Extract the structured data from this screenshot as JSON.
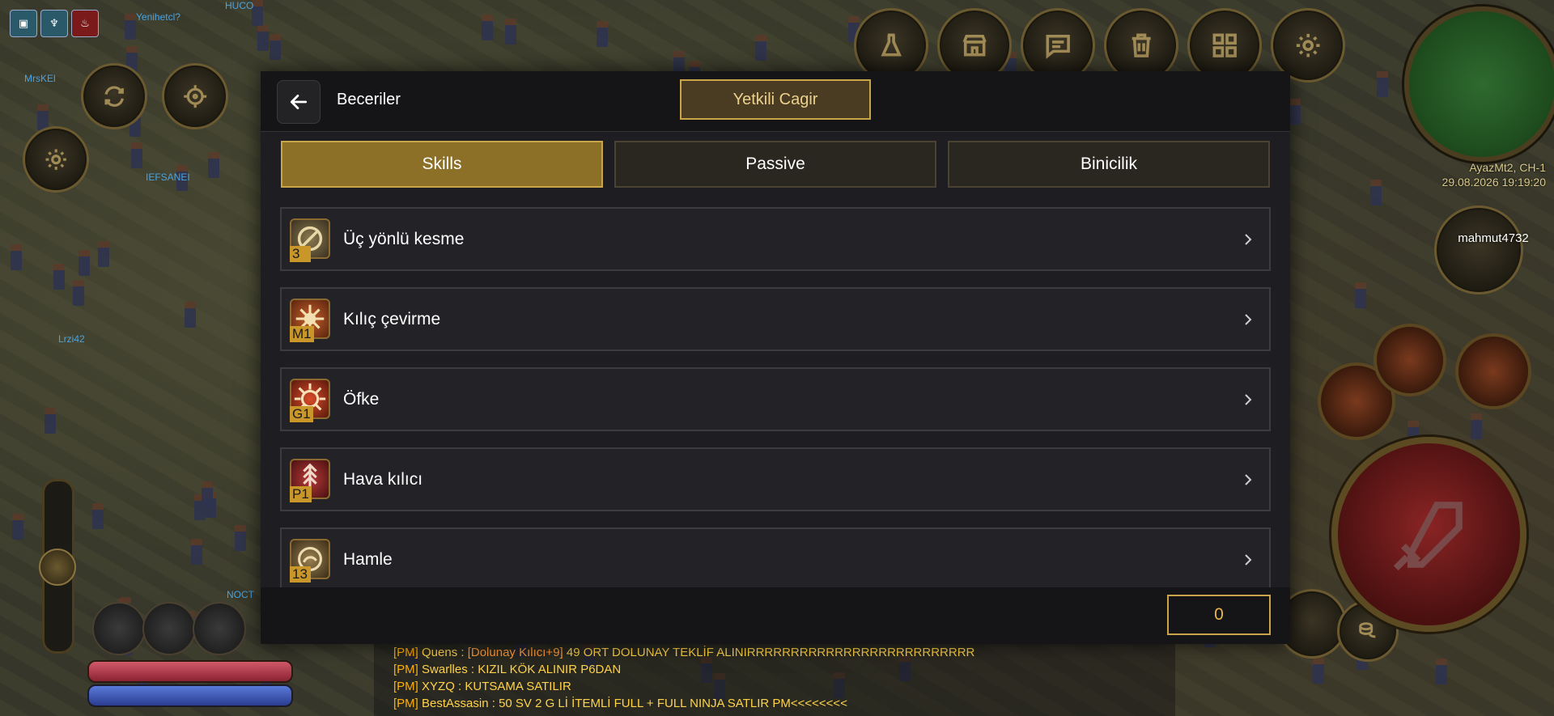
{
  "dialog": {
    "title": "Beceriler",
    "call_button": "Yetkili Cagir",
    "tabs": [
      {
        "label": "Skills",
        "active": true
      },
      {
        "label": "Passive",
        "active": false
      },
      {
        "label": "Binicilik",
        "active": false
      }
    ],
    "skills": [
      {
        "name": "Üç yönlü kesme",
        "level": "3",
        "icon": "sword-slash-icon"
      },
      {
        "name": "Kılıç çevirme",
        "level": "M1",
        "icon": "spinning-blade-icon"
      },
      {
        "name": "Öfke",
        "level": "G1",
        "icon": "rage-burst-icon"
      },
      {
        "name": "Hava kılıcı",
        "level": "P1",
        "icon": "aura-sword-icon"
      },
      {
        "name": "Hamle",
        "level": "13",
        "icon": "dash-icon"
      }
    ],
    "skill_points": "0"
  },
  "hud": {
    "server_name": "AyazMt2, CH-1",
    "datetime": "29.08.2026 19:19:20",
    "player_name": "mahmut4732",
    "nameplates": [
      "Yenihetcl?",
      "HUCO",
      "MrsKEl",
      "IEFSANEI",
      "Lrzi42",
      "NOCT"
    ],
    "chat": [
      {
        "tag": "[PM]",
        "sender": "Quens :",
        "item": "[Dolunay Kılıcı+9]",
        "text": "49 ORT DOLUNAY TEKLİF ALINIRRRRRRRRRRRRRRRRRRRRRRRRRR"
      },
      {
        "tag": "[PM]",
        "sender": "Swarlles :",
        "item": "",
        "text": "KIZIL KÖK ALINIR P6DAN"
      },
      {
        "tag": "[PM]",
        "sender": "XYZQ :",
        "item": "",
        "text": " KUTSAMA SATILIR"
      },
      {
        "tag": "[PM]",
        "sender": "BestAssasin :",
        "item": "",
        "text": "50 SV 2 G Lİ İTEMLİ FULL + FULL NINJA SATLIR PM<<<<<<<<"
      }
    ]
  },
  "colors": {
    "accent_gold": "#c9a449",
    "active_tab": "#8c7028",
    "panel": "#1e1e22"
  }
}
